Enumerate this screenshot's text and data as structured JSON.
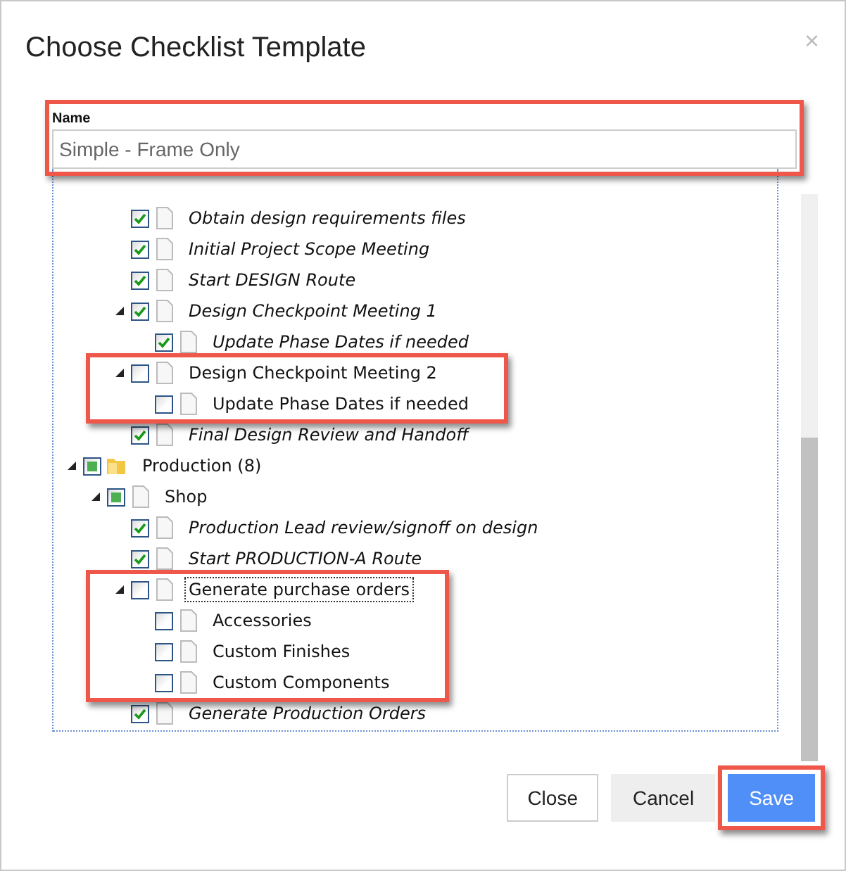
{
  "dialog": {
    "title": "Choose Checklist Template",
    "close_glyph": "×"
  },
  "name_field": {
    "label": "Name",
    "value": "Simple - Frame Only",
    "highlighted": true
  },
  "tree": {
    "items": [
      {
        "children": [
          {
            "children": [
              {
                "label": "Obtain design requirements files",
                "kind": "file",
                "checked": true,
                "focused": false,
                "highlighted": false
              },
              {
                "label": "Initial Project Scope Meeting",
                "kind": "file",
                "checked": true,
                "focused": false,
                "highlighted": false
              },
              {
                "label": "Start DESIGN Route",
                "kind": "file",
                "checked": true,
                "focused": false,
                "highlighted": false
              },
              {
                "label": "Design Checkpoint Meeting 1",
                "kind": "file",
                "checked": true,
                "expanded": true,
                "focused": false,
                "highlighted": false,
                "children": [
                  {
                    "label": "Update Phase Dates if needed",
                    "kind": "file",
                    "checked": true,
                    "focused": false,
                    "highlighted": false
                  }
                ]
              },
              {
                "label": "Design Checkpoint Meeting 2",
                "kind": "file",
                "checked": false,
                "partial": false,
                "expanded": true,
                "focused": false,
                "highlighted": true,
                "children": [
                  {
                    "label": "Update Phase Dates if needed",
                    "kind": "file",
                    "checked": false,
                    "partial": false,
                    "focused": false,
                    "highlighted": false
                  }
                ]
              },
              {
                "label": "Final Design Review and Handoff",
                "kind": "file",
                "checked": true,
                "focused": false,
                "highlighted": false
              }
            ]
          }
        ]
      },
      {
        "label": "Production (8)",
        "kind": "folder",
        "checked": false,
        "partial": true,
        "expanded": true,
        "focused": false,
        "highlighted": false,
        "children": [
          {
            "label": "Shop",
            "kind": "file",
            "checked": false,
            "partial": true,
            "expanded": true,
            "focused": false,
            "highlighted": false,
            "children": [
              {
                "label": "Production Lead review/signoff on design",
                "kind": "file",
                "checked": true,
                "focused": false,
                "highlighted": false
              },
              {
                "label": "Start PRODUCTION-A Route",
                "kind": "file",
                "checked": true,
                "focused": false,
                "highlighted": false
              },
              {
                "label": "Generate purchase orders",
                "kind": "file",
                "checked": false,
                "partial": false,
                "expanded": true,
                "focused": true,
                "highlighted": true,
                "children": [
                  {
                    "label": "Accessories",
                    "kind": "file",
                    "checked": false,
                    "partial": false,
                    "focused": false,
                    "highlighted": false
                  },
                  {
                    "label": "Custom Finishes",
                    "kind": "file",
                    "checked": false,
                    "partial": false,
                    "focused": false,
                    "highlighted": false
                  },
                  {
                    "label": "Custom Components",
                    "kind": "file",
                    "checked": false,
                    "partial": false,
                    "focused": false,
                    "highlighted": false
                  }
                ]
              },
              {
                "label": "Generate Production Orders",
                "kind": "file",
                "checked": true,
                "focused": false,
                "highlighted": false
              }
            ]
          }
        ]
      }
    ]
  },
  "buttons": [
    {
      "label": "Close",
      "kind": "outline",
      "highlighted": false
    },
    {
      "label": "Cancel",
      "kind": "flat",
      "highlighted": false
    },
    {
      "label": "Save",
      "kind": "primary",
      "highlighted": true
    }
  ]
}
